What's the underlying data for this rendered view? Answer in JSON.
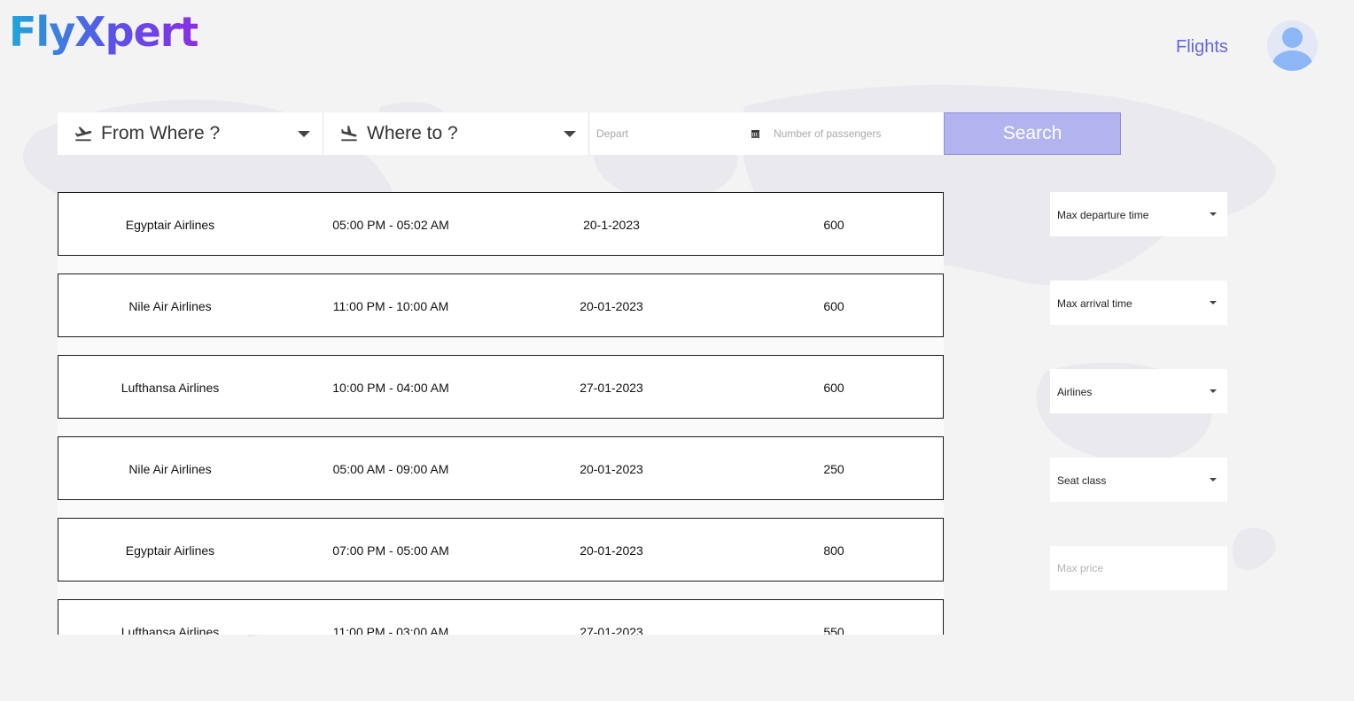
{
  "brand": {
    "logo_text": "FlyXpert"
  },
  "nav": {
    "flights_label": "Flights"
  },
  "search": {
    "from_label": "From Where ?",
    "to_label": "Where to ?",
    "depart_placeholder": "Depart",
    "passengers_placeholder": "Number of passengers",
    "button_label": "Search"
  },
  "flights": [
    {
      "airline": "Egyptair Airlines",
      "time": "05:00 PM - 05:02 AM",
      "date": "20-1-2023",
      "price": "600"
    },
    {
      "airline": "Nile Air Airlines",
      "time": "11:00 PM - 10:00 AM",
      "date": "20-01-2023",
      "price": "600"
    },
    {
      "airline": "Lufthansa Airlines",
      "time": "10:00 PM - 04:00 AM",
      "date": "27-01-2023",
      "price": "600"
    },
    {
      "airline": "Nile Air Airlines",
      "time": "05:00 AM - 09:00 AM",
      "date": "20-01-2023",
      "price": "250"
    },
    {
      "airline": "Egyptair Airlines",
      "time": "07:00 PM - 05:00 AM",
      "date": "20-01-2023",
      "price": "800"
    },
    {
      "airline": "Lufthansa Airlines",
      "time": "11:00 PM - 03:00 AM",
      "date": "27-01-2023",
      "price": "550"
    }
  ],
  "filters": {
    "max_departure": "Max departure time",
    "max_arrival": "Max arrival time",
    "airlines": "Airlines",
    "seat_class": "Seat class",
    "max_price_placeholder": "Max price"
  },
  "colors": {
    "accent": "#6466e0",
    "search_button": "#b3b3ef",
    "background": "#f3f3f4"
  },
  "icons": {
    "from": "plane-takeoff-icon",
    "to": "plane-landing-icon",
    "depart": "calendar-icon",
    "avatar": "user-avatar-icon"
  }
}
